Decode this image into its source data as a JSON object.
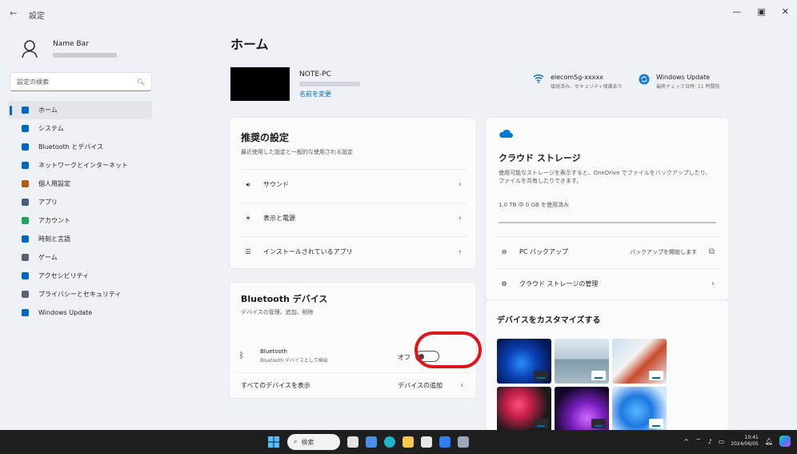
{
  "window": {
    "back_label": "←",
    "title": "設定",
    "minimize": "—",
    "maximize": "▣",
    "close": "✕"
  },
  "sidebar": {
    "user_name": "Name Bar",
    "search_placeholder": "設定の検索",
    "items": [
      {
        "label": "ホーム",
        "icon": "home-icon",
        "color": "#0067c0",
        "active": true
      },
      {
        "label": "システム",
        "icon": "system-icon",
        "color": "#0067c0"
      },
      {
        "label": "Bluetooth とデバイス",
        "icon": "bluetooth-icon",
        "color": "#0067c0"
      },
      {
        "label": "ネットワークとインターネット",
        "icon": "network-icon",
        "color": "#0067c0"
      },
      {
        "label": "個人用設定",
        "icon": "personalization-icon",
        "color": "#b05d1a"
      },
      {
        "label": "アプリ",
        "icon": "apps-icon",
        "color": "#4a5d7a"
      },
      {
        "label": "アカウント",
        "icon": "account-icon",
        "color": "#1aa55a"
      },
      {
        "label": "時刻と言語",
        "icon": "time-language-icon",
        "color": "#0067c0"
      },
      {
        "label": "ゲーム",
        "icon": "gaming-icon",
        "color": "#5a6170"
      },
      {
        "label": "アクセシビリティ",
        "icon": "accessibility-icon",
        "color": "#0067c0"
      },
      {
        "label": "プライバシーとセキュリティ",
        "icon": "privacy-icon",
        "color": "#5a6170"
      },
      {
        "label": "Windows Update",
        "icon": "windows-update-icon",
        "color": "#0067c0"
      }
    ]
  },
  "header": {
    "title": "ホーム",
    "device_name": "NOTE-PC",
    "rename_label": "名前を変更"
  },
  "status_items": [
    {
      "title": "elecomSg-xxxxx",
      "sub": "接続済み、セキュリティ保護あり",
      "icon": "wifi-icon"
    },
    {
      "title": "Windows Update",
      "sub": "最終チェック日時: 11 時間前",
      "icon": "windows-update-icon"
    }
  ],
  "recommended": {
    "title": "推奨の設定",
    "subtitle": "最近使用した設定と一般的な使用される設定",
    "rows": [
      {
        "label": "サウンド",
        "icon": "sound-icon"
      },
      {
        "label": "表示と電源",
        "icon": "display-power-icon"
      },
      {
        "label": "インストールされているアプリ",
        "icon": "installed-apps-icon"
      }
    ]
  },
  "bluetooth": {
    "title": "Bluetooth デバイス",
    "subtitle": "デバイスの管理、追加、削除",
    "device_label": "Bluetooth",
    "device_sub": "Bluetooth デバイスとして検出",
    "toggle_label": "オフ",
    "toggle_on": false,
    "footer_label": "すべてのデバイスを表示",
    "footer_button": "デバイスの追加"
  },
  "cloud": {
    "title": "クラウド ストレージ",
    "description": "使用可能なストレージを表示すると、OneDrive でファイルをバックアップしたり、ファイルを共有したりできます。",
    "usage_text": "1.0 TB 中 0 GB を使用済み",
    "usage_fraction": 0.0,
    "rows": [
      {
        "label": "PC バックアップ",
        "action": "バックアップを開始します",
        "icon": "backup-icon",
        "trailing": "open-icon"
      },
      {
        "label": "クラウド ストレージの管理",
        "icon": "manage-storage-icon",
        "trailing": "chevron"
      }
    ]
  },
  "customize": {
    "title": "デバイスをカスタマイズする"
  },
  "taskbar": {
    "search_label": "検索",
    "clock_time": "10:41",
    "clock_date": "2024/06/05"
  }
}
